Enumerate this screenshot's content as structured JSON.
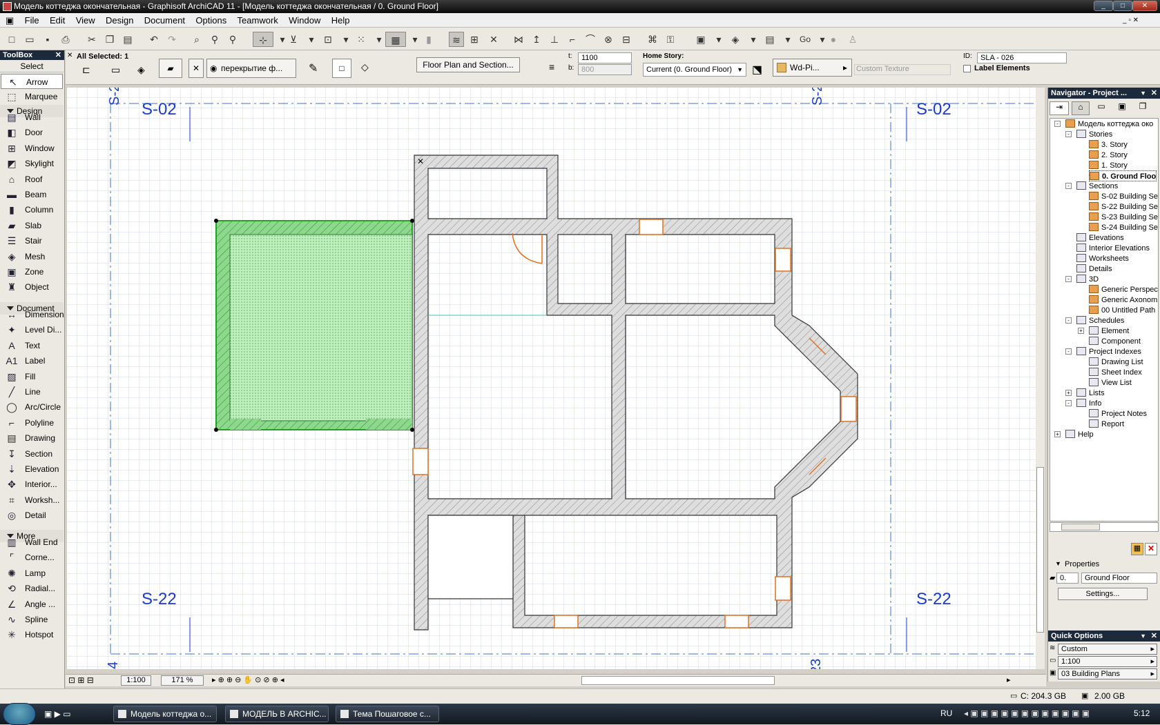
{
  "window": {
    "title": "Модель коттеджа окончательная - Graphisoft ArchiCAD 11 - [Модель коттеджа окончательная / 0. Ground Floor]"
  },
  "menu": [
    "File",
    "Edit",
    "View",
    "Design",
    "Document",
    "Options",
    "Teamwork",
    "Window",
    "Help"
  ],
  "toolbar": {
    "go_label": "Go"
  },
  "infobox": {
    "all_selected": "All Selected: 1",
    "layer_name": "перекрытие ф...",
    "floor_plan_section_button": "Floor Plan and Section...",
    "t_label": "t:",
    "t_value": "1100",
    "b_label": "b:",
    "b_value": "800",
    "home_story_label": "Home Story:",
    "home_story_value": "Current (0. Ground Floor)",
    "material": "Wd-Pi...",
    "custom_texture": "Custom Texture",
    "id_label": "ID:",
    "id_value": "SLA - 026",
    "label_elements": "Label Elements"
  },
  "toolbox": {
    "title": "ToolBox",
    "select_label": "Select",
    "arrow": "Arrow",
    "marquee": "Marquee",
    "design_section": "Design",
    "design_tools": [
      "Wall",
      "Door",
      "Window",
      "Skylight",
      "Roof",
      "Beam",
      "Column",
      "Slab",
      "Stair",
      "Mesh",
      "Zone",
      "Object"
    ],
    "document_section": "Document",
    "document_tools": [
      "Dimension",
      "Level Di...",
      "Text",
      "Label",
      "Fill",
      "Line",
      "Arc/Circle",
      "Polyline",
      "Drawing",
      "Section",
      "Elevation",
      "Interior...",
      "Worksh...",
      "Detail"
    ],
    "more_section": "More",
    "more_tools": [
      "Wall End",
      "Corne...",
      "Lamp",
      "Radial...",
      "Angle ...",
      "Spline",
      "Hotspot"
    ]
  },
  "canvas": {
    "section_markers": {
      "top_left": "S-02",
      "top_right": "S-02",
      "bottom_left": "S-22",
      "bottom_right": "S-22"
    },
    "edge_labels": {
      "top_left": "S-2",
      "top_right": "S-2",
      "bottom_left": "4",
      "bottom_right": "23"
    },
    "scale": "1:100",
    "zoom": "171 %"
  },
  "navigator": {
    "title": "Navigator - Project ...",
    "root": "Модель коттеджа око",
    "stories_label": "Stories",
    "stories": [
      "3. Story",
      "2. Story",
      "1. Story",
      "0. Ground Floo"
    ],
    "sections_label": "Sections",
    "sections": [
      "S-02 Building Sec",
      "S-22 Building Sec",
      "S-23 Building Sec",
      "S-24 Building Sec"
    ],
    "elevations": "Elevations",
    "interior_elevations": "Interior Elevations",
    "worksheets": "Worksheets",
    "details": "Details",
    "threed": "3D",
    "threed_items": [
      "Generic Perspec",
      "Generic Axonom",
      "00 Untitled Path"
    ],
    "schedules": "Schedules",
    "schedule_items": [
      "Element",
      "Component"
    ],
    "project_indexes": "Project Indexes",
    "index_items": [
      "Drawing List",
      "Sheet Index",
      "View List"
    ],
    "lists": "Lists",
    "info": "Info",
    "info_items": [
      "Project Notes",
      "Report"
    ],
    "help": "Help",
    "properties_label": "Properties",
    "prop_num": "0.",
    "prop_name": "Ground Floor",
    "settings_button": "Settings..."
  },
  "quick_options": {
    "title": "Quick Options",
    "items": [
      "Custom",
      "1:100",
      "03 Building Plans"
    ]
  },
  "status": {
    "disk": "C: 204.3 GB",
    "ram": "2.00 GB"
  },
  "taskbar": {
    "tasks": [
      "Модель коттеджа о...",
      "МОДЕЛЬ В ARCHIC...",
      "Тема Пошаговое с..."
    ],
    "lang": "RU",
    "time": "5:12"
  },
  "colors": {
    "selection_green": "#3cb83c",
    "wall_gray": "#dcdcdc",
    "marker_blue": "#1a3cc8",
    "opening_orange": "#e07020"
  }
}
